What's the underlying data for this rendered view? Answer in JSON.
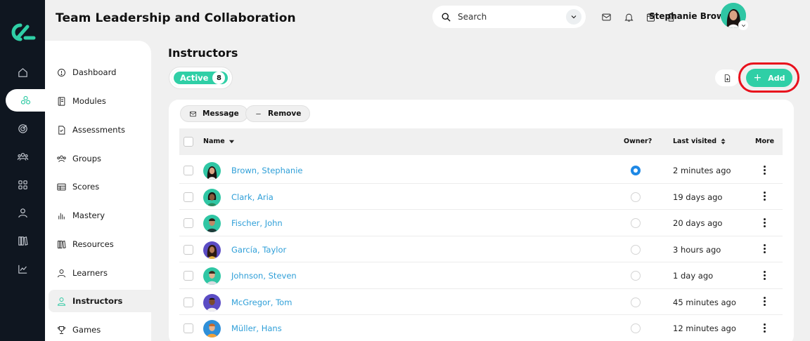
{
  "header": {
    "title": "Team Leadership and Collaboration",
    "search_placeholder": "Search",
    "user_name": "Stephanie Brown"
  },
  "rail": {
    "items": [
      "home-icon",
      "modules-icon",
      "target-icon",
      "groups-icon",
      "apps-icon",
      "person-icon",
      "library-icon",
      "analytics-icon"
    ],
    "active_index": 1
  },
  "sidebar": {
    "items": [
      {
        "label": "Dashboard",
        "icon": "dashboard-icon"
      },
      {
        "label": "Modules",
        "icon": "book-icon"
      },
      {
        "label": "Assessments",
        "icon": "assessment-icon"
      },
      {
        "label": "Groups",
        "icon": "groups-icon"
      },
      {
        "label": "Scores",
        "icon": "table-icon"
      },
      {
        "label": "Mastery",
        "icon": "bars-icon"
      },
      {
        "label": "Resources",
        "icon": "resources-icon"
      },
      {
        "label": "Learners",
        "icon": "learner-icon"
      },
      {
        "label": "Instructors",
        "icon": "instructor-icon"
      },
      {
        "label": "Games",
        "icon": "trophy-icon"
      }
    ],
    "active": "Instructors"
  },
  "main": {
    "title": "Instructors",
    "filter": {
      "label": "Active",
      "count": "8"
    },
    "add_label": "Add",
    "actions": {
      "message": "Message",
      "remove": "Remove"
    },
    "columns": {
      "name": "Name",
      "owner": "Owner?",
      "last_visited": "Last visited",
      "more": "More"
    },
    "rows": [
      {
        "name": "Brown, Stephanie",
        "owner": true,
        "last_visited": "2 minutes ago"
      },
      {
        "name": "Clark, Aria",
        "owner": false,
        "last_visited": "19 days ago"
      },
      {
        "name": "Fischer, John",
        "owner": false,
        "last_visited": "20 days ago"
      },
      {
        "name": "García, Taylor",
        "owner": false,
        "last_visited": "3 hours ago"
      },
      {
        "name": "Johnson, Steven",
        "owner": false,
        "last_visited": "1 day ago"
      },
      {
        "name": "McGregor, Tom",
        "owner": false,
        "last_visited": "45 minutes ago"
      },
      {
        "name": "Müller, Hans",
        "owner": false,
        "last_visited": "12 minutes ago"
      }
    ]
  },
  "colors": {
    "accent": "#2fcfa6",
    "link": "#2f9fd8",
    "highlight_ring": "#e8101c",
    "rail_bg": "#0f1620"
  }
}
